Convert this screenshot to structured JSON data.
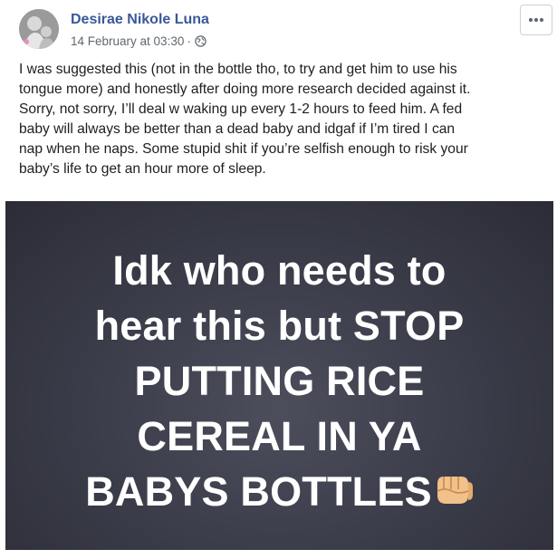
{
  "post": {
    "author": "Desirae Nikole Luna",
    "date": "14 February at 03:30",
    "separator": "·",
    "privacy_icon": "globe-icon",
    "more_icon": "more-options-icon",
    "text_lines": [
      "I was suggested this (not in the bottle tho, to try and get him to use his",
      "tongue more) and honestly after doing more research decided against it.",
      "Sorry, not sorry, I’ll deal w waking up every 1-2 hours to feed him. A fed",
      "baby will always be better than a dead baby and idgaf if I’m tired I can",
      "nap when he naps. Some stupid shit if you’re selfish enough to risk your",
      "baby’s life to get an hour more of sleep."
    ],
    "photo": {
      "lines": [
        "Idk who needs to",
        "hear this but STOP",
        "PUTTING RICE",
        "CEREAL IN YA",
        "BABYS BOTTLES"
      ],
      "emoji_icon": "fist-bump-icon"
    }
  },
  "colors": {
    "author": "#385898",
    "meta": "#606770",
    "photo_bg": "#3c3e4b"
  }
}
